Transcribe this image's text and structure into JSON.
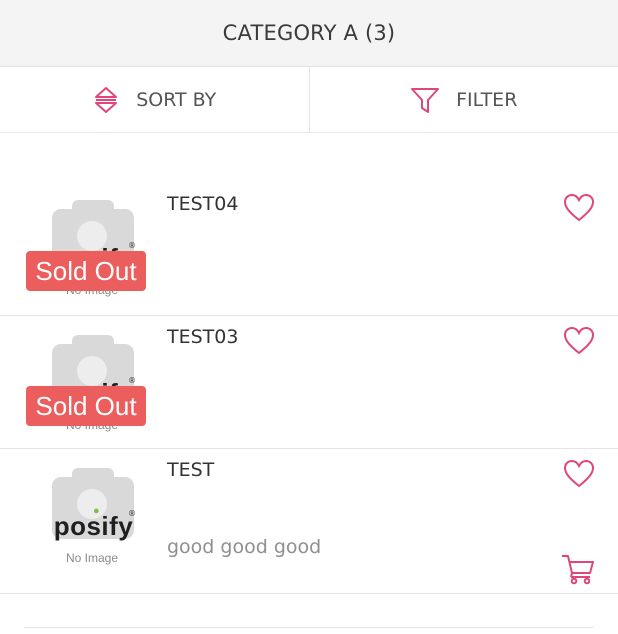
{
  "header": {
    "title": "CATEGORY A (3)"
  },
  "toolbar": {
    "sort_label": "SORT BY",
    "filter_label": "FILTER"
  },
  "colors": {
    "accent": "#e0467c",
    "sold_out": "#ec5d5d"
  },
  "products": [
    {
      "name": "TEST04",
      "badge": "Sold Out",
      "description": "",
      "brand": "posify",
      "image_text": "No Image"
    },
    {
      "name": "TEST03",
      "badge": "Sold Out",
      "description": "",
      "brand": "posify",
      "image_text": "No Image"
    },
    {
      "name": "TEST",
      "badge": "",
      "description": "good good good",
      "brand": "posify",
      "image_text": "No Image"
    }
  ]
}
